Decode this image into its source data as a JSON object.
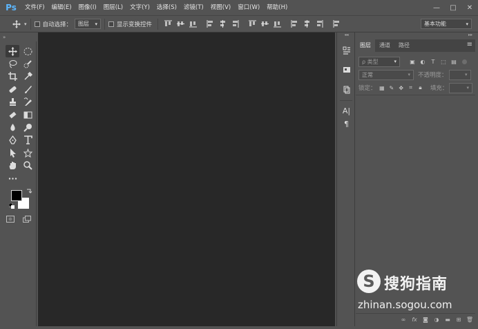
{
  "app": {
    "logo": "Ps"
  },
  "menu": [
    {
      "label": "文件(F)",
      "name": "menu-file"
    },
    {
      "label": "编辑(E)",
      "name": "menu-edit"
    },
    {
      "label": "图像(I)",
      "name": "menu-image"
    },
    {
      "label": "图层(L)",
      "name": "menu-layer"
    },
    {
      "label": "文字(Y)",
      "name": "menu-type"
    },
    {
      "label": "选择(S)",
      "name": "menu-select"
    },
    {
      "label": "滤镜(T)",
      "name": "menu-filter"
    },
    {
      "label": "视图(V)",
      "name": "menu-view"
    },
    {
      "label": "窗口(W)",
      "name": "menu-window"
    },
    {
      "label": "帮助(H)",
      "name": "menu-help"
    }
  ],
  "options": {
    "auto_select_label": "自动选择：",
    "auto_select_value": "图层",
    "show_transform_label": "显示变换控件",
    "workspace_value": "基本功能"
  },
  "layers_panel": {
    "tabs": [
      {
        "label": "图层",
        "active": true
      },
      {
        "label": "通道",
        "active": false
      },
      {
        "label": "路径",
        "active": false
      }
    ],
    "filter_placeholder": "ρ 类型",
    "blend_mode": "正常",
    "opacity_label": "不透明度：",
    "lock_label": "锁定：",
    "fill_label": "填充："
  },
  "watermark": {
    "logo_letter": "S",
    "brand": "搜狗指南",
    "url": "zhinan.sogou.com"
  },
  "colors": {
    "ui_bg": "#535353",
    "canvas_bg": "#282828",
    "ps_blue": "#5cb7ff",
    "foreground": "#000000",
    "background": "#ffffff"
  }
}
